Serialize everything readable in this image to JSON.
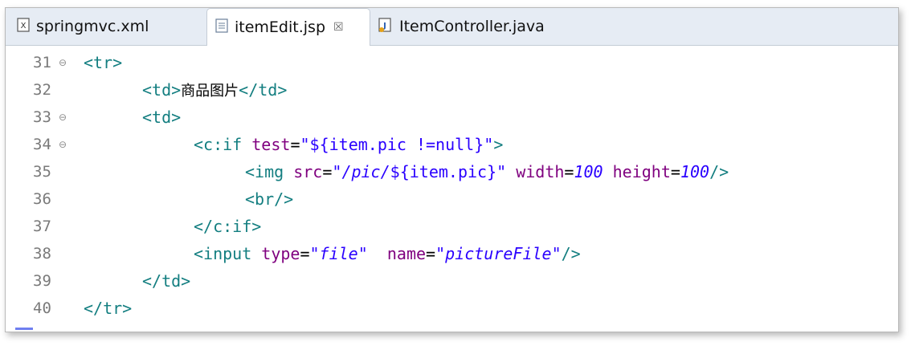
{
  "tabs": [
    {
      "label": "springmvc.xml",
      "icon": "xml-file-icon",
      "active": false
    },
    {
      "label": "itemEdit.jsp",
      "icon": "jsp-file-icon",
      "active": true,
      "close": "☒"
    },
    {
      "label": "ItemController.java",
      "icon": "java-file-icon",
      "active": false
    }
  ],
  "lines": [
    {
      "num": "31",
      "fold": "⊖"
    },
    {
      "num": "32",
      "fold": ""
    },
    {
      "num": "33",
      "fold": "⊖"
    },
    {
      "num": "34",
      "fold": "⊖"
    },
    {
      "num": "35",
      "fold": ""
    },
    {
      "num": "36",
      "fold": ""
    },
    {
      "num": "37",
      "fold": ""
    },
    {
      "num": "38",
      "fold": ""
    },
    {
      "num": "39",
      "fold": ""
    },
    {
      "num": "40",
      "fold": ""
    }
  ],
  "code": {
    "l31": {
      "tag": "<tr>"
    },
    "l32": {
      "open": "<td>",
      "text": "商品图片",
      "close": "</td>"
    },
    "l33": {
      "tag": "<td>"
    },
    "l34": {
      "open": "<c:if",
      "attr": "test",
      "eq": "=",
      "val": "\"${item.pic !=null}\"",
      "end": ">"
    },
    "l35": {
      "open": "<img",
      "a1": "src",
      "eq": "=",
      "q1": "\"",
      "v1": "/pic/",
      "v1b": "${item.pic}",
      "q2": "\"",
      "a2": "width",
      "eq2": "=",
      "v2": "100",
      "a3": "height",
      "eq3": "=",
      "v3": "100",
      "end": "/>"
    },
    "l36": {
      "tag": "<br/>"
    },
    "l37": {
      "tag": "</c:if>"
    },
    "l38": {
      "open": "<input",
      "a1": "type",
      "eq": "=",
      "v1": "\"file\"",
      "a2": "name",
      "eq2": "=",
      "v2": "\"pictureFile\"",
      "end": "/>"
    },
    "l39": {
      "tag": "</td>"
    },
    "l40": {
      "tag": "</tr>"
    }
  },
  "colors": {
    "tag": "#137e80",
    "attr": "#7f007f",
    "value": "#2a00ff",
    "line_number": "#7a7a7a"
  }
}
